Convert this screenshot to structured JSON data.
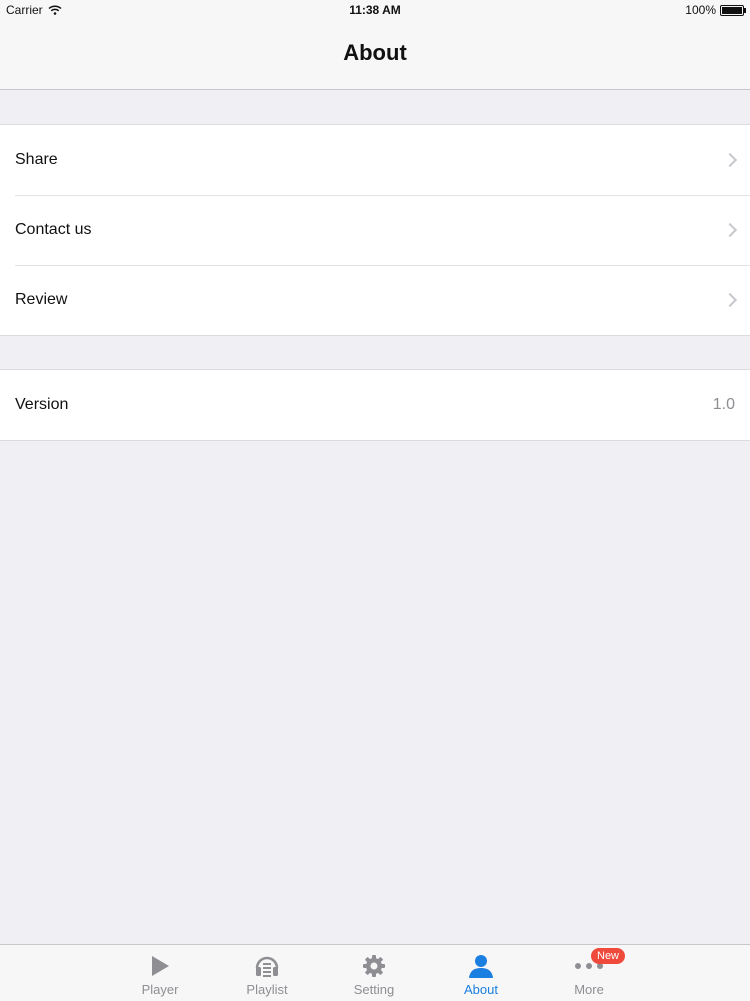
{
  "status_bar": {
    "carrier": "Carrier",
    "time": "11:38 AM",
    "battery": "100%",
    "battery_level": 1.0
  },
  "nav": {
    "title": "About"
  },
  "groups": [
    {
      "rows": [
        {
          "label": "Share"
        },
        {
          "label": "Contact us"
        },
        {
          "label": "Review"
        }
      ]
    },
    {
      "rows": [
        {
          "label": "Version",
          "value": "1.0"
        }
      ]
    }
  ],
  "tabs": [
    {
      "label": "Player",
      "icon": "play-icon"
    },
    {
      "label": "Playlist",
      "icon": "playlist-icon"
    },
    {
      "label": "Setting",
      "icon": "gear-icon"
    },
    {
      "label": "About",
      "icon": "person-icon",
      "active": true
    },
    {
      "label": "More",
      "icon": "more-icon",
      "badge": "New"
    }
  ],
  "colors": {
    "accent": "#1a7fe0",
    "badge": "#ef4a3c",
    "inactive": "#8e8e93",
    "background": "#efeff4"
  }
}
